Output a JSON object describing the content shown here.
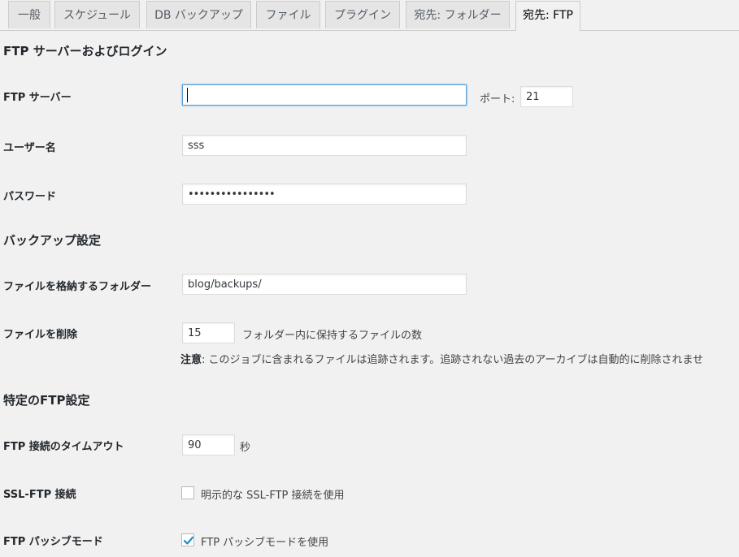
{
  "tabs": [
    {
      "label": "一般"
    },
    {
      "label": "スケジュール"
    },
    {
      "label": "DB バックアップ"
    },
    {
      "label": "ファイル"
    },
    {
      "label": "プラグイン"
    },
    {
      "label": "宛先: フォルダー"
    },
    {
      "label": "宛先: FTP"
    }
  ],
  "sections": {
    "ftp_server_login": {
      "title": "FTP サーバーおよびログイン",
      "server_label": "FTP サーバー",
      "server_value": "",
      "port_label": "ポート:",
      "port_value": "21",
      "username_label": "ユーザー名",
      "username_value": "sss",
      "password_label": "パスワード",
      "password_value": "••••••••••••••••"
    },
    "backup_settings": {
      "title": "バックアップ設定",
      "folder_label": "ファイルを格納するフォルダー",
      "folder_value": "blog/backups/",
      "delete_label": "ファイルを削除",
      "delete_value": "15",
      "delete_suffix": "フォルダー内に保持するファイルの数",
      "note_bold": "注意",
      "note_text": ": このジョブに含まれるファイルは追跡されます。追跡されない過去のアーカイブは自動的に削除されませ"
    },
    "specific_ftp": {
      "title": "特定のFTP設定",
      "timeout_label": "FTP 接続のタイムアウト",
      "timeout_value": "90",
      "timeout_unit": "秒",
      "ssl_label": "SSL-FTP 接続",
      "ssl_checkbox_label": "明示的な SSL-FTP 接続を使用",
      "ssl_checked": false,
      "passive_label": "FTP パッシブモード",
      "passive_checkbox_label": "FTP パッシブモードを使用",
      "passive_checked": true
    }
  },
  "colors": {
    "background": "#f1f1f1",
    "tab_inactive": "#e5e5e5",
    "focus_border": "#5b9dd9",
    "check_mark": "#1e8cbe"
  }
}
